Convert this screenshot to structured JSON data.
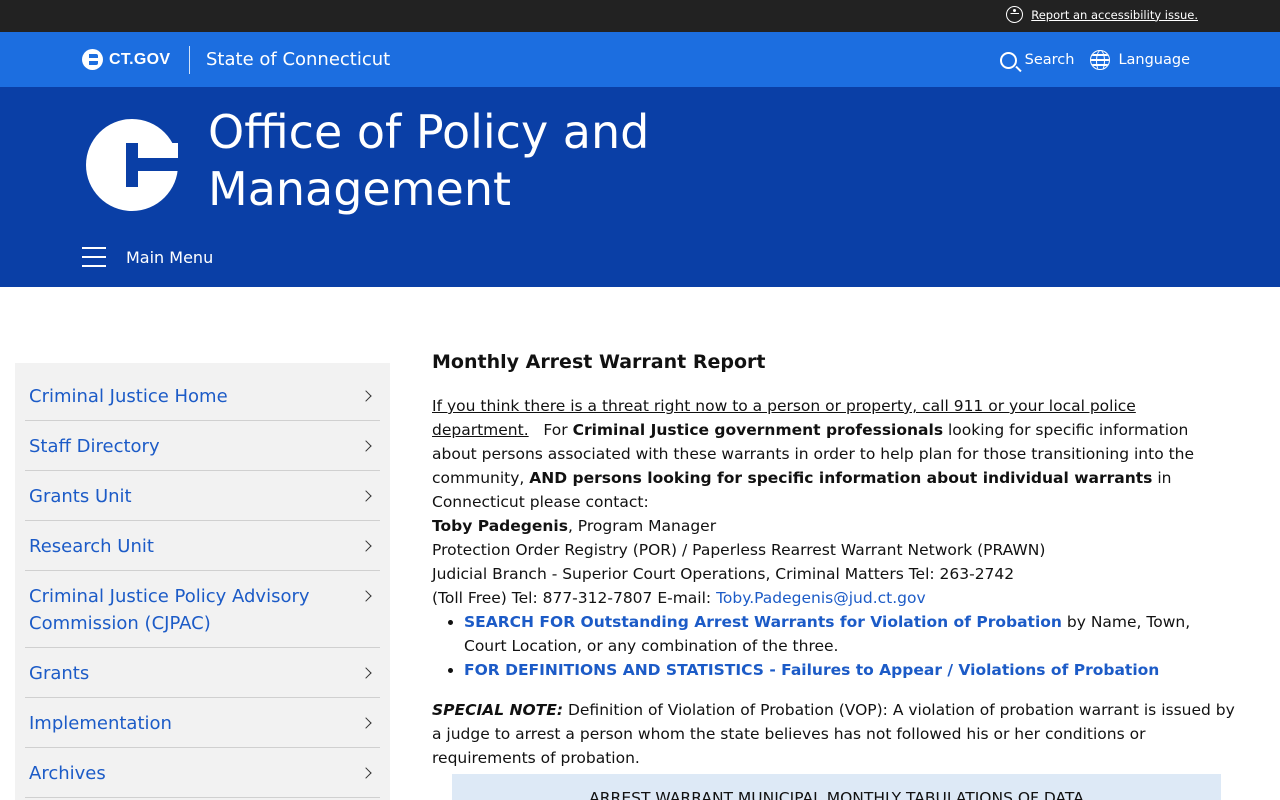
{
  "util_bar": {
    "a11y_link": "Report an accessibility issue."
  },
  "ct_bar": {
    "logo_text": "CT.GOV",
    "state_name": "State of Connecticut",
    "search_label": "Search",
    "language_label": "Language"
  },
  "agency": {
    "title": "Office of Policy and Management",
    "menu_label": "Main Menu"
  },
  "sidebar": {
    "items": [
      {
        "label": "Criminal Justice Home"
      },
      {
        "label": "Staff Directory"
      },
      {
        "label": "Grants Unit"
      },
      {
        "label": "Research Unit"
      },
      {
        "label": "Criminal Justice Policy Advisory Commission (CJPAC)"
      },
      {
        "label": "Grants"
      },
      {
        "label": "Implementation"
      },
      {
        "label": "Archives"
      }
    ]
  },
  "main": {
    "heading": "Monthly Arrest Warrant Report",
    "threat_link": "If you think there is a threat right now to a person or property, call 911 or your local police department.",
    "p1_a": "For ",
    "p1_b": "Criminal Justice government professionals",
    "p1_c": " looking for specific information about persons associated with these warrants in order to help plan for those transitioning into the community, ",
    "p1_d": "AND persons looking for specific information about individual warrants",
    "p1_e": " in Connecticut please contact:",
    "contact_name": "Toby Padegenis",
    "contact_role": ", Program Manager",
    "contact_line2": "Protection Order Registry (POR) / Paperless Rearrest Warrant Network (PRAWN)",
    "contact_line3": "Judicial Branch - Superior Court Operations, Criminal Matters Tel:  263-2742",
    "contact_line4": "(Toll Free) Tel: 877-312-7807 E-mail: ",
    "contact_email": "Toby.Padegenis@jud.ct.gov",
    "bullet1_link": "SEARCH FOR Outstanding Arrest Warrants for Violation of Probation",
    "bullet1_rest": " by Name, Town, Court Location, or any combination of the three.",
    "bullet2_link": "FOR DEFINITIONS AND STATISTICS - Failures to Appear / Violations of Probation",
    "special_label": "SPECIAL NOTE:",
    "special_text": " Definition of Violation of Probation (VOP): A violation of probation warrant is issued by a judge to arrest a person whom the state believes has not followed his or her conditions or requirements of probation.",
    "table_heading": "ARREST WARRANT MUNICIPAL MONTHLY TABULATIONS OF DATA"
  }
}
